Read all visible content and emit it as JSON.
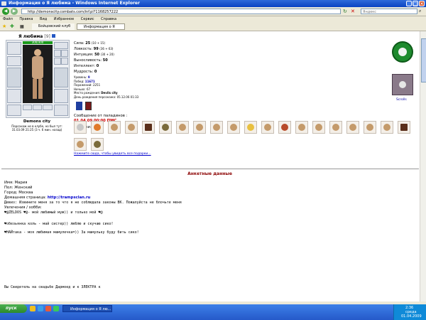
{
  "window": {
    "title": "Информация о Я любима - Windows Internet Explorer",
    "url": "http://demonscity.combats.com/inf.pl?1168257222",
    "search_placeholder": "Яндекс"
  },
  "menu": [
    "Файл",
    "Правка",
    "Вид",
    "Избранное",
    "Сервис",
    "Справка"
  ],
  "tabs": [
    {
      "label": "Бойцовский клуб"
    },
    {
      "label": "Информация о Я любима"
    }
  ],
  "character": {
    "name": "Я любима",
    "level": "[9]",
    "hp_bar": "300/300",
    "city": "Demons city",
    "location_note": "Персонаж не в клубе, но был тут:",
    "last_seen": "31.03.09 21:25 (3 ч. 6 мин. назад)"
  },
  "stats": [
    {
      "label": "Сила:",
      "value": "25",
      "extra": "(10 + 15)"
    },
    {
      "label": "Ловкость:",
      "value": "99",
      "extra": "(36 + 63)"
    },
    {
      "label": "Интуиция:",
      "value": "50",
      "extra": "(30 + 20)"
    },
    {
      "label": "Выносливость:",
      "value": "50",
      "extra": ""
    },
    {
      "label": "Интеллект:",
      "value": "0",
      "extra": ""
    },
    {
      "label": "Мудрость:",
      "value": "0",
      "extra": ""
    }
  ],
  "details": [
    {
      "label": "Уровень:",
      "value": "9"
    },
    {
      "label": "Побед:",
      "value": "11671"
    },
    {
      "label": "Поражений:",
      "value": "2251"
    },
    {
      "label": "Ничьих:",
      "value": "67"
    },
    {
      "label": "Место рождения:",
      "value": "Devils city"
    },
    {
      "label": "День рождения персонажа:",
      "value": "05.12.06 01:33"
    }
  ],
  "paladin": {
    "label": "Сообщение от паладинов :",
    "date": "01.04.09 00:00 ПМС"
  },
  "gifts_label": "Подарки:",
  "gifts_link": "Нажмите сюда, чтобы увидеть все подарки...",
  "scrolls_label": "Scrolls",
  "section_title": "Анкетные данные",
  "profile": {
    "name": "Имя: Мария",
    "gender": "Пол: Женский",
    "city": "Город: Москва",
    "homepage_label": "Домашняя страница:",
    "homepage_url": "http://trampsclan.ru",
    "wife_note": "Девиз: Извините меня за то что я не соблюдала законы ВК. Пожалуйста не блочьте меня",
    "hobbies": "Увлечения / хобби:",
    "line1": "♥@ZELDOS ♥@- мой любимый муж))  и только мой ♥@",
    "line2": "♥обезьянка коль - май систер)) люблю и скучаю сико!",
    "line3": "♥НАЙтака - моя любимая мамулечка=)) За мамульку буду бить сико!",
    "line4": "Вы Свидетель на свадьбе Дармоед и к ЗЛЕКТРА к"
  },
  "taskbar": {
    "start": "пуск",
    "task": "Информация о Я лю...",
    "time": "2:36",
    "day": "среда",
    "date": "01.04.2009"
  },
  "colors": {
    "titlebar": "#0a43c2",
    "accent_red": "#cc0000",
    "accent_green": "#0a8a00",
    "link_blue": "#0000cc"
  }
}
